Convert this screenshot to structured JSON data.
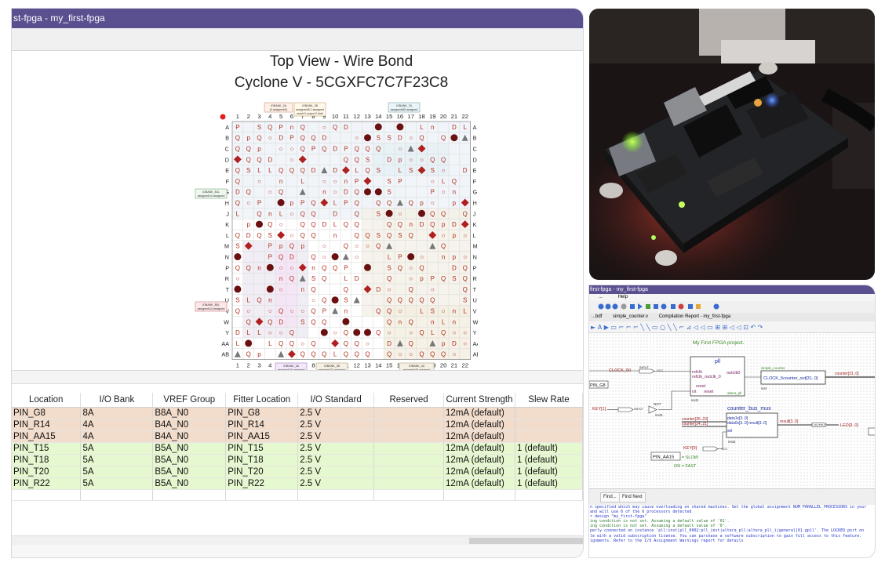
{
  "main_window": {
    "title": "st-fpga - my_first-fpga",
    "view_title": "Top View - Wire Bond",
    "device_title": "Cyclone V - 5CGXFC7C7F23C8",
    "columns": [
      "1",
      "2",
      "3",
      "4",
      "5",
      "6",
      "7",
      "8",
      "9",
      "10",
      "11",
      "12",
      "13",
      "14",
      "15",
      "16",
      "17",
      "18",
      "19",
      "20",
      "21",
      "22"
    ],
    "rows": [
      "A",
      "B",
      "C",
      "D",
      "E",
      "F",
      "G",
      "H",
      "J",
      "K",
      "L",
      "M",
      "N",
      "P",
      "R",
      "T",
      "U",
      "V",
      "W",
      "Y",
      "AA",
      "AB"
    ],
    "bank_labels": {
      "top_left": [
        "IOBANK_3A",
        "(0 assigned/0)"
      ],
      "top_mid": [
        "IOBANK_3B",
        "assigned/8.2 assigned",
        "result 0 output 0 bidir"
      ],
      "top_right": [
        "IOBANK_7A",
        "assigned/85 assigned"
      ],
      "left_top": [
        "IOBANK_B1L",
        "assigned/14 assigned"
      ],
      "left_bottom": [
        "IOBANK_B0L",
        "assigned/14 assigned"
      ],
      "right_top": [
        "IOBANK_5B",
        "assigned/14 assigned"
      ],
      "right_mid": [
        "IOBANK_5A",
        "assigned/16 assigned",
        "result 4 output 0 bidir"
      ],
      "bottom_left": [
        "IOBANK_3A",
        "assigned/16 assigned"
      ],
      "bottom_mid": [
        "IOBANK_3B",
        "assigned/32 assigned"
      ],
      "bottom_right": [
        "IOBANK_4A",
        "assigned/48 assigned",
        "result 0 output 0 bidir"
      ]
    },
    "pin_table": {
      "headers": [
        "Location",
        "I/O Bank",
        "VREF Group",
        "Fitter Location",
        "I/O Standard",
        "Reserved",
        "Current Strength",
        "Slew Rate"
      ],
      "rows": [
        [
          "PIN_G8",
          "8A",
          "B8A_N0",
          "PIN_G8",
          "2.5 V",
          "",
          "12mA (default)",
          ""
        ],
        [
          "PIN_R14",
          "4A",
          "B4A_N0",
          "PIN_R14",
          "2.5 V",
          "",
          "12mA (default)",
          ""
        ],
        [
          "PIN_AA15",
          "4A",
          "B4A_N0",
          "PIN_AA15",
          "2.5 V",
          "",
          "12mA (default)",
          ""
        ],
        [
          "PIN_T15",
          "5A",
          "B5A_N0",
          "PIN_T15",
          "2.5 V",
          "",
          "12mA (default)",
          "1 (default)"
        ],
        [
          "PIN_T18",
          "5A",
          "B5A_N0",
          "PIN_T18",
          "2.5 V",
          "",
          "12mA (default)",
          "1 (default)"
        ],
        [
          "PIN_T20",
          "5A",
          "B5A_N0",
          "PIN_T20",
          "2.5 V",
          "",
          "12mA (default)",
          "1 (default)"
        ],
        [
          "PIN_R22",
          "5A",
          "B5A_N0",
          "PIN_R22",
          "2.5 V",
          "",
          "12mA (default)",
          "1 (default)"
        ]
      ]
    }
  },
  "block_diagram": {
    "title": "first-fpga - my_first-fpga",
    "menu": [
      "...",
      "Help"
    ],
    "tabs": [
      "...bdf",
      "simple_counter.v",
      "Compilation Report - my_first-fpga"
    ],
    "canvas_title": "My First FPGA project.",
    "pll": {
      "name": "pll",
      "ports_in": [
        "refclk",
        "rst"
      ],
      "ports_out": [
        "outclk0"
      ],
      "ports_mid": [
        "refclk_outclk_0",
        "reset",
        "reset"
      ],
      "ip": "altera_pll",
      "instance": "inst1"
    },
    "counter": {
      "name": "simple_counter",
      "port": "CLOCK_5counter_out[31..0]",
      "instance": "inst"
    },
    "mux": {
      "name": "counter_bus_mux",
      "ports_in": [
        "data1x[3..0]",
        "data0x[3..0]",
        "sel"
      ],
      "ports_out": [
        "result[3..0]"
      ],
      "instance": "inst2"
    },
    "signals": {
      "clock_pin": "CLOCK_50",
      "clock_pin_loc": "PIN_G8",
      "input_label": "INPUT",
      "vcc": "VCC",
      "not_gate": "NOT",
      "not_inst": "inst3",
      "key1": "KEY[1]",
      "key0": "KEY[0]",
      "key0_pin": "PIN_AA15",
      "counter_out": "counter[31..0]",
      "bus_a": "counter[26..23]",
      "bus_b": "counter[24..21]",
      "result_bus": "result[3..0]",
      "output_label": "OUTPUT",
      "led": "LED[3..0]",
      "slow": "= SLOW",
      "fast": "ON = FAST"
    },
    "buttons": [
      "Find...",
      "Find Next"
    ],
    "messages": [
      "n specified which may cause overloading on shared machines.  Set the global assignment NUM_PARALLEL_PROCESSORS in your",
      "and will use 6 of the 6 processors detected",
      "r design \"my_first-fpga\"",
      "ing condition is not set. Assuming a default value of '01'.",
      "ing condition is not set. Assuming a default value of '0'.",
      "perly connected on instance 'pll:inst|pll_0002:pll_inst|altera_pll:altera_pll_i|general[0].gpll'. The LOCKED port on",
      "le with a valid subscription license. You can purchase a software subscription to gain full access to this feature.",
      "ignments. Refer to the I/O Assignment Warnings report for details"
    ]
  },
  "colors": {
    "title_bar": "#5a4f8f",
    "bank_a_row": "#f2dccb",
    "bank_b_row": "#e6f8cf",
    "pin_text": "#c0392b"
  }
}
